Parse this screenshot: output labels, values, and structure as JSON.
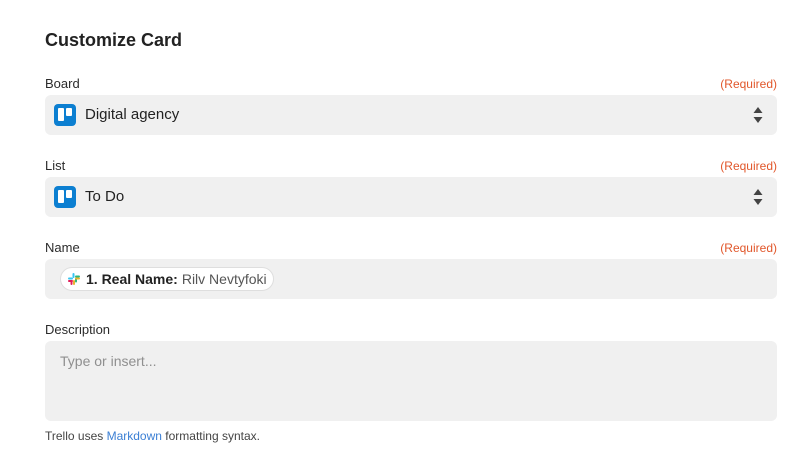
{
  "title": "Customize Card",
  "required_label": "(Required)",
  "board": {
    "label": "Board",
    "value": "Digital agency",
    "icon": "trello-icon"
  },
  "list": {
    "label": "List",
    "value": "To Do",
    "icon": "trello-icon"
  },
  "name": {
    "label": "Name",
    "chip_key": "1. Real Name:",
    "chip_value": "Rilv Nevtyfoki",
    "chip_icon": "slack-icon"
  },
  "description": {
    "label": "Description",
    "placeholder": "Type or insert..."
  },
  "hint": {
    "prefix": "Trello uses ",
    "link": "Markdown",
    "suffix": " formatting syntax."
  },
  "colors": {
    "required": "#e1572b",
    "link": "#3b7fd4",
    "trello": "#0c7fd1",
    "field_bg": "#f0f0f0"
  }
}
